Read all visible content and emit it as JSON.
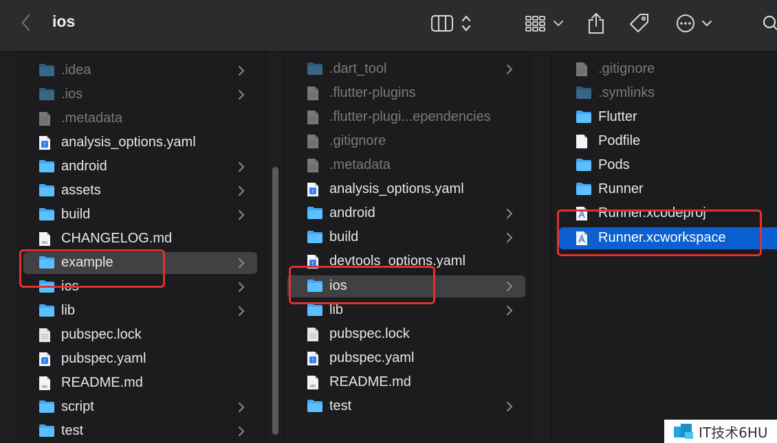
{
  "toolbar": {
    "title": "ios",
    "icons": [
      "chevron-left-icon",
      "column-view-icon",
      "sort-arrows-icon",
      "grid-view-icon",
      "share-icon",
      "tag-icon",
      "more-icon",
      "search-icon"
    ]
  },
  "columns": [
    {
      "items": [
        {
          "label": ".idea",
          "kind": "folder",
          "dim": true,
          "chevron": true
        },
        {
          "label": ".ios",
          "kind": "folder",
          "dim": true,
          "chevron": true
        },
        {
          "label": ".metadata",
          "kind": "doc",
          "dim": true,
          "chevron": false
        },
        {
          "label": "analysis_options.yaml",
          "kind": "yaml",
          "dim": false,
          "chevron": false
        },
        {
          "label": "android",
          "kind": "folder",
          "dim": false,
          "chevron": true
        },
        {
          "label": "assets",
          "kind": "folder",
          "dim": false,
          "chevron": true
        },
        {
          "label": "build",
          "kind": "folder",
          "dim": false,
          "chevron": true
        },
        {
          "label": "CHANGELOG.md",
          "kind": "md",
          "dim": false,
          "chevron": false
        },
        {
          "label": "example",
          "kind": "folder",
          "dim": false,
          "chevron": true,
          "selected": "gray"
        },
        {
          "label": "ios",
          "kind": "folder",
          "dim": false,
          "chevron": true
        },
        {
          "label": "lib",
          "kind": "folder",
          "dim": false,
          "chevron": true
        },
        {
          "label": "pubspec.lock",
          "kind": "doc",
          "dim": false,
          "chevron": false
        },
        {
          "label": "pubspec.yaml",
          "kind": "yaml",
          "dim": false,
          "chevron": false
        },
        {
          "label": "README.md",
          "kind": "md",
          "dim": false,
          "chevron": false
        },
        {
          "label": "script",
          "kind": "folder",
          "dim": false,
          "chevron": true
        },
        {
          "label": "test",
          "kind": "folder",
          "dim": false,
          "chevron": true
        }
      ]
    },
    {
      "items": [
        {
          "label": ".dart_tool",
          "kind": "folder",
          "dim": true,
          "chevron": true
        },
        {
          "label": ".flutter-plugins",
          "kind": "doc",
          "dim": true,
          "chevron": false
        },
        {
          "label": ".flutter-plugi...ependencies",
          "kind": "doc",
          "dim": true,
          "chevron": false
        },
        {
          "label": ".gitignore",
          "kind": "doc",
          "dim": true,
          "chevron": false
        },
        {
          "label": ".metadata",
          "kind": "doc",
          "dim": true,
          "chevron": false
        },
        {
          "label": "analysis_options.yaml",
          "kind": "yaml",
          "dim": false,
          "chevron": false
        },
        {
          "label": "android",
          "kind": "folder",
          "dim": false,
          "chevron": true
        },
        {
          "label": "build",
          "kind": "folder",
          "dim": false,
          "chevron": true
        },
        {
          "label": "devtools_options.yaml",
          "kind": "yaml",
          "dim": false,
          "chevron": false
        },
        {
          "label": "ios",
          "kind": "folder",
          "dim": false,
          "chevron": true,
          "selected": "gray"
        },
        {
          "label": "lib",
          "kind": "folder",
          "dim": false,
          "chevron": true
        },
        {
          "label": "pubspec.lock",
          "kind": "doc",
          "dim": false,
          "chevron": false
        },
        {
          "label": "pubspec.yaml",
          "kind": "yaml",
          "dim": false,
          "chevron": false
        },
        {
          "label": "README.md",
          "kind": "md",
          "dim": false,
          "chevron": false
        },
        {
          "label": "test",
          "kind": "folder",
          "dim": false,
          "chevron": true
        }
      ]
    },
    {
      "items": [
        {
          "label": ".gitignore",
          "kind": "doc",
          "dim": true,
          "chevron": false
        },
        {
          "label": ".symlinks",
          "kind": "folder",
          "dim": true,
          "chevron": false
        },
        {
          "label": "Flutter",
          "kind": "folder",
          "dim": false,
          "chevron": false
        },
        {
          "label": "Podfile",
          "kind": "plain",
          "dim": false,
          "chevron": false
        },
        {
          "label": "Pods",
          "kind": "folder",
          "dim": false,
          "chevron": false
        },
        {
          "label": "Runner",
          "kind": "folder",
          "dim": false,
          "chevron": false
        },
        {
          "label": "Runner.xcodeproj",
          "kind": "xcode",
          "dim": false,
          "chevron": false
        },
        {
          "label": "Runner.xcworkspace",
          "kind": "xcode",
          "dim": false,
          "chevron": false,
          "selected": "blue"
        }
      ]
    }
  ],
  "watermark": {
    "text": "IT技术6HU"
  },
  "colors": {
    "folder": "#3fa9f5",
    "selection_blue": "#0b5fd0",
    "highlight_red": "#e0312e"
  }
}
